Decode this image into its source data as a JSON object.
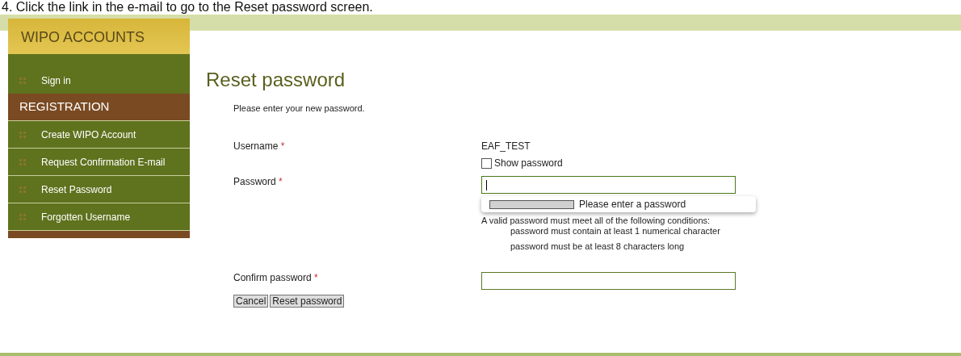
{
  "caption": "4. Click the link in the e-mail to go to the Reset password screen.",
  "sidebar": {
    "title": "WIPO ACCOUNTS",
    "items": [
      {
        "kind": "link",
        "label": "Sign in"
      },
      {
        "kind": "heading",
        "label": "REGISTRATION"
      },
      {
        "kind": "link",
        "label": "Create WIPO Account"
      },
      {
        "kind": "link",
        "label": "Request Confirmation E-mail"
      },
      {
        "kind": "link",
        "label": "Reset Password"
      },
      {
        "kind": "link",
        "label": "Forgotten Username"
      }
    ]
  },
  "page_title": "Reset password",
  "intro": "Please enter your new password.",
  "form": {
    "username": {
      "label": "Username",
      "required_mark": "*",
      "value": "EAF_TEST"
    },
    "show_password": {
      "label": "Show password",
      "checked": false
    },
    "password": {
      "label": "Password",
      "required_mark": "*",
      "focused": true
    },
    "strength": {
      "level": 0,
      "message": "Please enter a password"
    },
    "conditions": {
      "heading": "A valid password must meet all of the following conditions:",
      "items": [
        "password must contain at least 1 numerical character",
        "password must be at least 8 characters long"
      ]
    },
    "confirm": {
      "label": "Confirm password",
      "required_mark": "*"
    },
    "buttons": [
      "Cancel",
      "Reset password"
    ]
  }
}
